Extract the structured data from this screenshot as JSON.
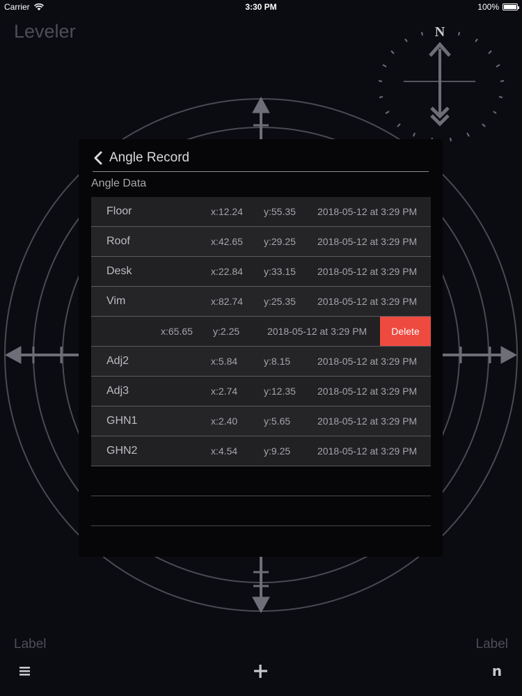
{
  "status_bar": {
    "carrier": "Carrier",
    "time": "3:30 PM",
    "battery": "100%"
  },
  "app": {
    "title": "Leveler",
    "compass_letter": "N"
  },
  "modal": {
    "title": "Angle Record",
    "section_label": "Angle Data",
    "rows": [
      {
        "name": "Floor",
        "x": "x:12.24",
        "y": "y:55.35",
        "date": "2018-05-12 at 3:29 PM"
      },
      {
        "name": "Roof",
        "x": "x:42.65",
        "y": "y:29.25",
        "date": "2018-05-12 at 3:29 PM"
      },
      {
        "name": "Desk",
        "x": "x:22.84",
        "y": "y:33.15",
        "date": "2018-05-12 at 3:29 PM"
      },
      {
        "name": "Vim",
        "x": "x:82.74",
        "y": "y:25.35",
        "date": "2018-05-12 at 3:29 PM"
      },
      {
        "name": "",
        "x": "x:65.65",
        "y": "y:2.25",
        "date": "2018-05-12 at 3:29 PM",
        "swiped": true,
        "action": "Delete"
      },
      {
        "name": "Adj2",
        "x": "x:5.84",
        "y": "y:8.15",
        "date": "2018-05-12 at 3:29 PM"
      },
      {
        "name": "Adj3",
        "x": "x:2.74",
        "y": "y:12.35",
        "date": "2018-05-12 at 3:29 PM"
      },
      {
        "name": "GHN1",
        "x": "x:2.40",
        "y": "y:5.65",
        "date": "2018-05-12 at 3:29 PM"
      },
      {
        "name": "GHN2",
        "x": "x:4.54",
        "y": "y:9.25",
        "date": "2018-05-12 at 3:29 PM"
      }
    ]
  },
  "bottom": {
    "left_label": "Label",
    "right_label": "Label",
    "menu_icon": "menu-icon",
    "add_icon": "plus-icon",
    "n_glyph": "n"
  },
  "colors": {
    "background": "#0b0b12",
    "modal": "#060608",
    "row": "#212124",
    "delete": "#ef4a3f",
    "guides": "#6e6e78"
  }
}
